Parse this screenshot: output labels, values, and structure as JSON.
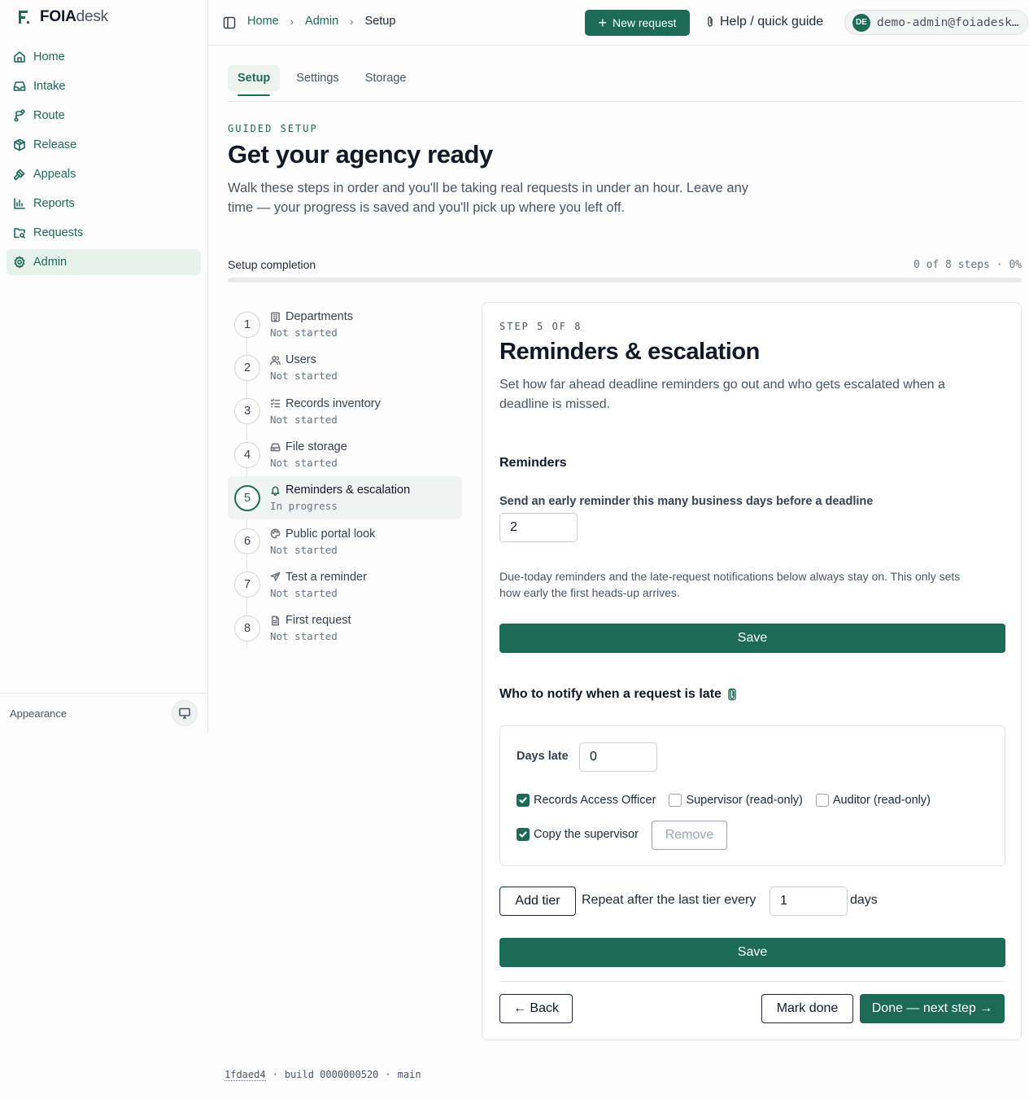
{
  "brand": {
    "bold": "FOIA",
    "light": "desk"
  },
  "nav": [
    {
      "label": "Home",
      "icon": "home-icon"
    },
    {
      "label": "Intake",
      "icon": "inbox-icon"
    },
    {
      "label": "Route",
      "icon": "route-icon"
    },
    {
      "label": "Release",
      "icon": "package-icon"
    },
    {
      "label": "Appeals",
      "icon": "gavel-icon"
    },
    {
      "label": "Reports",
      "icon": "bar-chart-icon"
    },
    {
      "label": "Requests",
      "icon": "folder-search-icon"
    },
    {
      "label": "Admin",
      "icon": "gear-icon",
      "active": true
    }
  ],
  "sidebar_footer": {
    "label": "Appearance"
  },
  "topbar": {
    "breadcrumbs": [
      "Home",
      "Admin",
      "Setup"
    ],
    "new_request": "New request",
    "help": "Help / quick guide",
    "avatar_initials": "DE",
    "user_email": "demo-admin@foiadesk.local"
  },
  "tabs": [
    {
      "label": "Setup",
      "active": true
    },
    {
      "label": "Settings"
    },
    {
      "label": "Storage"
    }
  ],
  "header": {
    "eyebrow": "GUIDED SETUP",
    "title": "Get your agency ready",
    "description": "Walk these steps in order and you'll be taking real requests in under an hour. Leave any time — your progress is saved and you'll pick up where you left off."
  },
  "progress": {
    "label": "Setup completion",
    "count": "0 of 8 steps · 0%",
    "fraction": 0
  },
  "steps": [
    {
      "num": "1",
      "title": "Departments",
      "status": "Not started",
      "icon": "building-icon"
    },
    {
      "num": "2",
      "title": "Users",
      "status": "Not started",
      "icon": "users-icon"
    },
    {
      "num": "3",
      "title": "Records inventory",
      "status": "Not started",
      "icon": "list-checks-icon"
    },
    {
      "num": "4",
      "title": "File storage",
      "status": "Not started",
      "icon": "hard-drive-icon"
    },
    {
      "num": "5",
      "title": "Reminders & escalation",
      "status": "In progress",
      "icon": "bell-icon",
      "active": true
    },
    {
      "num": "6",
      "title": "Public portal look",
      "status": "Not started",
      "icon": "palette-icon"
    },
    {
      "num": "7",
      "title": "Test a reminder",
      "status": "Not started",
      "icon": "send-icon"
    },
    {
      "num": "8",
      "title": "First request",
      "status": "Not started",
      "icon": "file-text-icon"
    }
  ],
  "card": {
    "eyebrow": "STEP 5 OF 8",
    "title": "Reminders & escalation",
    "description": "Set how far ahead deadline reminders go out and who gets escalated when a deadline is missed.",
    "reminders": {
      "heading": "Reminders",
      "field_label": "Send an early reminder this many business days before a deadline",
      "value": "2",
      "note": "Due-today reminders and the late-request notifications below always stay on. This only sets how early the first heads-up arrives.",
      "save": "Save"
    },
    "late": {
      "heading": "Who to notify when a request is late",
      "days_late_label": "Days late",
      "days_late_value": "0",
      "roles": [
        {
          "label": "Records Access Officer",
          "checked": true
        },
        {
          "label": "Supervisor (read-only)",
          "checked": false
        },
        {
          "label": "Auditor (read-only)",
          "checked": false
        }
      ],
      "copy_supervisor": {
        "label": "Copy the supervisor",
        "checked": true
      },
      "remove": "Remove",
      "add_tier": "Add tier",
      "repeat_prefix": "Repeat after the last tier every",
      "repeat_value": "1",
      "repeat_suffix": "days",
      "save": "Save"
    },
    "actions": {
      "back": "← Back",
      "mark_done": "Mark done",
      "next": "Done — next step →"
    }
  },
  "footer": {
    "hash": "1fdaed4",
    "build": "build 0000000520",
    "branch": "main"
  }
}
